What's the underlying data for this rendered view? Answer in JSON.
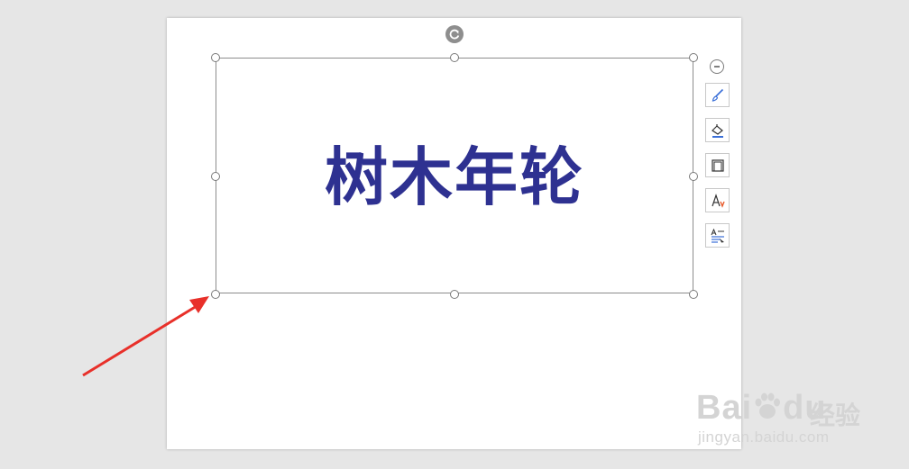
{
  "slide": {
    "textbox": {
      "text": "树木年轮",
      "text_color": "#2e3191"
    }
  },
  "side_toolbar": {
    "collapse_icon": "minus-circle-icon",
    "tools": [
      {
        "name": "shape-style",
        "icon": "paintbrush-icon"
      },
      {
        "name": "shape-fill",
        "icon": "paint-bucket-icon"
      },
      {
        "name": "shape-outline",
        "icon": "outline-square-icon"
      },
      {
        "name": "text-effects",
        "icon": "text-effect-icon"
      },
      {
        "name": "text-layout",
        "icon": "text-wrap-icon"
      }
    ]
  },
  "annotation": {
    "arrow_color": "#e8302a"
  },
  "watermark": {
    "brand": "Bai",
    "brand_suffix": "du",
    "brand_cn": "经验",
    "url": "jingyan.baidu.com"
  }
}
